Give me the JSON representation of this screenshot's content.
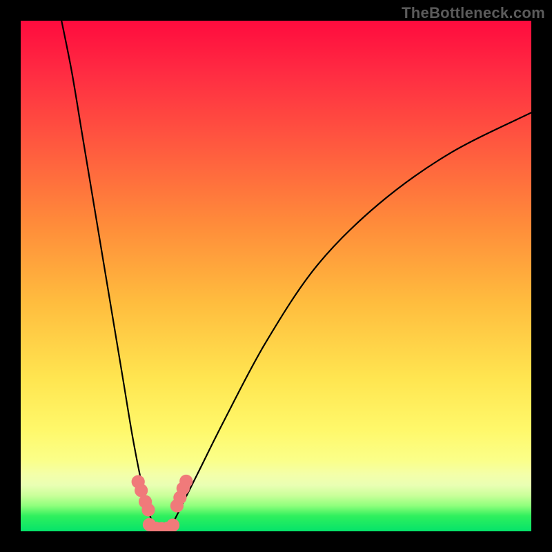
{
  "watermark": "TheBottleneck.com",
  "colors": {
    "red": "#ff0b3e",
    "orange": "#ff8c3a",
    "yellow": "#ffe550",
    "pale": "#fbff88",
    "green": "#05e36a",
    "marker": "#f07a7a",
    "curve": "#000000",
    "frame": "#000000"
  },
  "chart_data": {
    "type": "line",
    "title": "",
    "xlabel": "",
    "ylabel": "",
    "xlim": [
      0,
      100
    ],
    "ylim": [
      0,
      100
    ],
    "series": [
      {
        "name": "left-branch",
        "x": [
          8,
          10,
          12,
          14,
          16,
          18,
          20,
          22,
          24,
          25.5,
          26.5
        ],
        "y": [
          100,
          90,
          78,
          66,
          54,
          42,
          30,
          18,
          8,
          2.5,
          0.5
        ]
      },
      {
        "name": "right-branch",
        "x": [
          29,
          30,
          32,
          35,
          40,
          48,
          58,
          70,
          84,
          100
        ],
        "y": [
          0.5,
          2,
          6,
          12,
          22,
          37,
          52,
          64,
          74,
          82
        ]
      },
      {
        "name": "valley-floor",
        "x": [
          25,
          26.5,
          28,
          29.5
        ],
        "y": [
          1.2,
          0.3,
          0.3,
          1.0
        ]
      }
    ],
    "markers": [
      {
        "name": "left-cluster-top-1",
        "x": 23.0,
        "y": 9.7,
        "r": 1.3
      },
      {
        "name": "left-cluster-top-2",
        "x": 23.6,
        "y": 8.0,
        "r": 1.3
      },
      {
        "name": "left-cluster-mid-1",
        "x": 24.4,
        "y": 5.8,
        "r": 1.3
      },
      {
        "name": "left-cluster-mid-2",
        "x": 25.0,
        "y": 4.2,
        "r": 1.3
      },
      {
        "name": "valley-left-1",
        "x": 25.2,
        "y": 1.3,
        "r": 1.3
      },
      {
        "name": "valley-left-2",
        "x": 26.4,
        "y": 0.6,
        "r": 1.3
      },
      {
        "name": "valley-center",
        "x": 27.6,
        "y": 0.5,
        "r": 1.3
      },
      {
        "name": "valley-right-1",
        "x": 28.8,
        "y": 0.6,
        "r": 1.3
      },
      {
        "name": "valley-right-2",
        "x": 29.8,
        "y": 1.2,
        "r": 1.3
      },
      {
        "name": "right-cluster-low-1",
        "x": 30.6,
        "y": 5.0,
        "r": 1.3
      },
      {
        "name": "right-cluster-low-2",
        "x": 31.2,
        "y": 6.6,
        "r": 1.3
      },
      {
        "name": "right-cluster-top-1",
        "x": 31.8,
        "y": 8.4,
        "r": 1.3
      },
      {
        "name": "right-cluster-top-2",
        "x": 32.4,
        "y": 9.8,
        "r": 1.3
      }
    ]
  }
}
